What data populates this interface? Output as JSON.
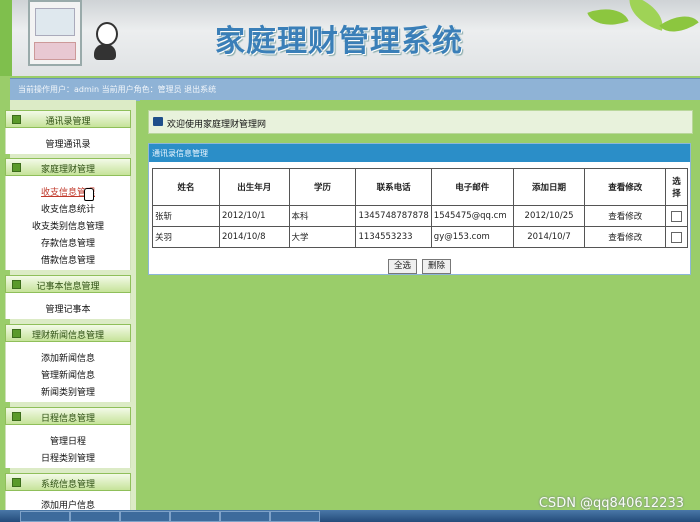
{
  "banner": {
    "title": "家庭理财管理系统"
  },
  "status": {
    "text": "当前操作用户：admin 当前用户角色：管理员   退出系统"
  },
  "sidebar": {
    "groups": [
      {
        "label": "通讯录管理",
        "items": [
          "管理通讯录"
        ]
      },
      {
        "label": "家庭理财管理",
        "items": [
          "收支信息管理",
          "收支信息统计",
          "收支类别信息管理",
          "存款信息管理",
          "借款信息管理"
        ]
      },
      {
        "label": "记事本信息管理",
        "items": [
          "管理记事本"
        ]
      },
      {
        "label": "理财新闻信息管理",
        "items": [
          "添加新闻信息",
          "管理新闻信息",
          "新闻类别管理"
        ]
      },
      {
        "label": "日程信息管理",
        "items": [
          "管理日程",
          "日程类别管理"
        ]
      },
      {
        "label": "系统信息管理",
        "items": [
          "添加用户信息"
        ]
      }
    ]
  },
  "main": {
    "welcome": "欢迎使用家庭理财管理网",
    "panel_title": "通讯录信息管理",
    "table": {
      "headers": [
        "姓名",
        "出生年月",
        "学历",
        "联系电话",
        "电子邮件",
        "添加日期",
        "查看修改",
        "选择"
      ],
      "rows": [
        {
          "name": "张斩",
          "birth": "2012/10/1",
          "edu": "本科",
          "phone": "1345748787878",
          "email": "1545475@qq.cm",
          "date": "2012/10/25",
          "action": "查看修改"
        },
        {
          "name": "关羽",
          "birth": "2014/10/8",
          "edu": "大学",
          "phone": "1134553233",
          "email": "gy@153.com",
          "date": "2014/10/7",
          "action": "查看修改"
        }
      ]
    },
    "buttons": {
      "select_all": "全选",
      "delete": "删除"
    }
  },
  "watermark": "CSDN @qq840612233",
  "colors": {
    "page_bg": "#9acd6a",
    "panel_header": "#2b8ec8",
    "status_bar": "#8fb3d6",
    "title": "#3a7fb8"
  }
}
